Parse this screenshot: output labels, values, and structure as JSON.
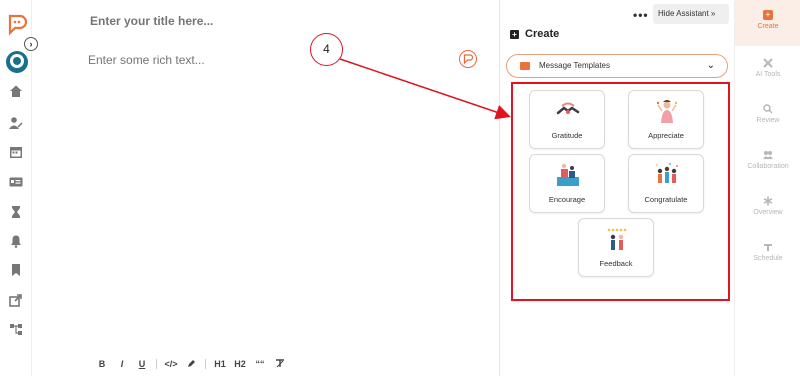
{
  "editor": {
    "title_placeholder": "Enter your title here...",
    "body_placeholder": "Enter some rich text..."
  },
  "toolbar": {
    "bold": "B",
    "italic": "I",
    "underline": "U",
    "code": "</>",
    "h1": "H1",
    "h2": "H2",
    "quote": "““"
  },
  "assistant": {
    "more": "•••",
    "hide_label": "Hide Assistant »",
    "create_title": "Create",
    "template_select": "Message Templates",
    "templates": [
      {
        "label": "Gratitude"
      },
      {
        "label": "Appreciate"
      },
      {
        "label": "Encourage"
      },
      {
        "label": "Congratulate"
      },
      {
        "label": "Feedback"
      }
    ]
  },
  "annotation": {
    "step": "4"
  },
  "right_rail": {
    "tabs": [
      {
        "label": "Create",
        "icon": "plus-icon"
      },
      {
        "label": "AI Tools",
        "icon": "tools-icon"
      },
      {
        "label": "Review",
        "icon": "search-icon"
      },
      {
        "label": "Collaboration",
        "icon": "people-icon"
      },
      {
        "label": "Overview",
        "icon": "asterisk-icon"
      },
      {
        "label": "Schedule",
        "icon": "schedule-icon"
      }
    ]
  },
  "colors": {
    "accent": "#e8743c",
    "annotation_red": "#e0141e"
  }
}
